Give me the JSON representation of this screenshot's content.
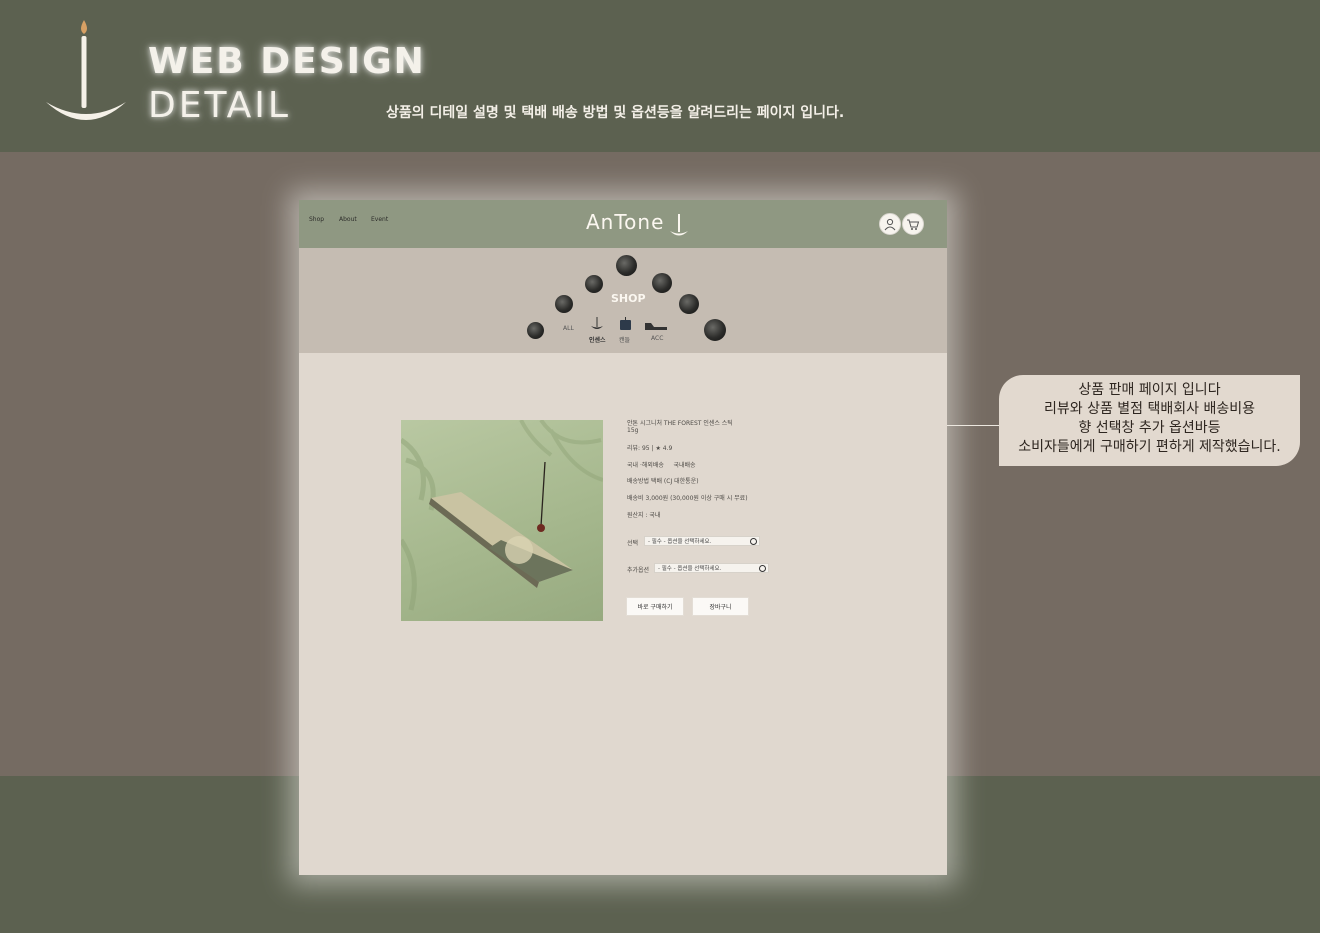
{
  "page": {
    "title_line1": "WEB DESIGN",
    "title_line2": "DETAIL",
    "subtitle": "상품의 디테일 설명 및 택배 배송 방법 및 옵션등을 알려드리는 페이지 입니다."
  },
  "mockup": {
    "nav": {
      "shop": "Shop",
      "about": "About",
      "event": "Event",
      "brand": "AnTone"
    },
    "banner": {
      "title": "SHOP",
      "categories": {
        "all": "ALL",
        "incense": "인센스",
        "candle": "캔들",
        "acc": "ACC"
      }
    },
    "product": {
      "name": "안톤 시그니처 THE FOREST 인센스 스틱",
      "weight": "15g",
      "review": "리뷰: 95 | ★ 4.9",
      "domestic": "국내 ·해외배송     국내배송",
      "shipping_method": "배송방법  택배 (CJ 대한통운)",
      "shipping_fee": "배송비   3,000원 (30,000원 이상 구매 시 무료)",
      "origin": "원산지 : 국내",
      "option_label": "선택",
      "option_value": "- 필수 - 옵션을 선택하세요.",
      "extra_option_label": "추가옵션",
      "extra_option_value": "- 필수 - 옵션을 선택하세요.",
      "buy_now": "바로 구매하기",
      "cart": "장바구니"
    }
  },
  "callout": {
    "line1": "상품 판매 페이지 입니다",
    "line2": "리뷰와 상품 별점 택배회사 배송비용",
    "line3": "향 선택창 추가 옵션바등",
    "line4": "소비자들에게 구매하기 편하게 제작했습니다."
  },
  "colors": {
    "top_band": "#5c6150",
    "middle": "#756b62",
    "mock_bg": "#e0d8cf",
    "mock_nav": "#8f9882",
    "callout": "#e2d9cf"
  },
  "icons": [
    "candle-logo-icon",
    "user-icon",
    "cart-icon",
    "moon-icon",
    "incense-icon",
    "candle-icon",
    "acc-icon",
    "chevron-down-icon"
  ]
}
